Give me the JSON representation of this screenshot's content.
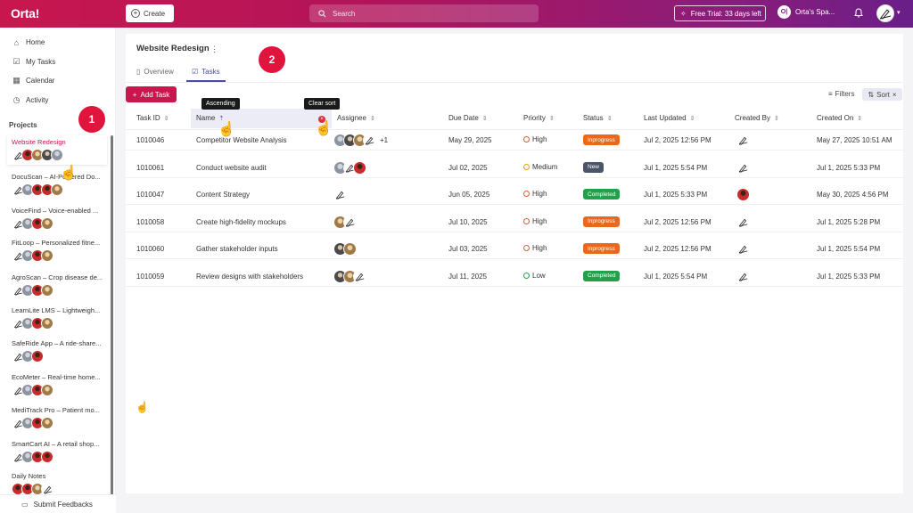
{
  "topbar": {
    "logo": "Orta!",
    "create_label": "Create",
    "search_placeholder": "Search",
    "trial_label": "Free Trial: 33 days left",
    "space_initials": "O|",
    "space_name": "Orta's Spa..."
  },
  "sidebar": {
    "nav": [
      {
        "label": "Home",
        "icon": "home-icon"
      },
      {
        "label": "My Tasks",
        "icon": "checkbox-icon"
      },
      {
        "label": "Calendar",
        "icon": "calendar-icon"
      },
      {
        "label": "Activity",
        "icon": "activity-icon"
      }
    ],
    "projects_title": "Projects",
    "projects": [
      {
        "name": "Website Redesign",
        "avatars": [
          "pen",
          "red",
          "brown",
          "dark",
          "grey"
        ],
        "active": true
      },
      {
        "name": "DocuScan – AI-Powered Do...",
        "avatars": [
          "pen",
          "grey",
          "red",
          "red",
          "brown"
        ]
      },
      {
        "name": "VoiceFind – Voice-enabled ...",
        "avatars": [
          "pen",
          "grey",
          "red",
          "brown"
        ]
      },
      {
        "name": "FitLoop – Personalized fitne...",
        "avatars": [
          "pen",
          "grey",
          "red",
          "brown"
        ]
      },
      {
        "name": "AgroScan – Crop disease de...",
        "avatars": [
          "pen",
          "grey",
          "red",
          "brown"
        ]
      },
      {
        "name": "LearnLite LMS – Lightweigh...",
        "avatars": [
          "pen",
          "grey",
          "red",
          "brown"
        ]
      },
      {
        "name": "SafeRide App – A ride-share...",
        "avatars": [
          "pen",
          "grey",
          "red"
        ]
      },
      {
        "name": "EcoMeter – Real-time home...",
        "avatars": [
          "pen",
          "grey",
          "red",
          "brown"
        ]
      },
      {
        "name": "MediTrack Pro – Patient mo...",
        "avatars": [
          "pen",
          "grey",
          "red",
          "brown"
        ]
      },
      {
        "name": "SmartCart AI – A retail shop...",
        "avatars": [
          "pen",
          "grey",
          "red",
          "red"
        ]
      },
      {
        "name": "Daily Notes",
        "avatars": [
          "red",
          "red",
          "brown",
          "pen"
        ]
      }
    ],
    "feedback_label": "Submit Feedbacks"
  },
  "main": {
    "project_title": "Website Redesign",
    "tabs": [
      {
        "label": "Overview"
      },
      {
        "label": "Tasks"
      }
    ],
    "add_task_label": "Add Task",
    "filters_label": "Filters",
    "sort_label": "Sort",
    "columns": [
      "Task ID",
      "Name",
      "Assignee",
      "Due Date",
      "Priority",
      "Status",
      "Last Updated",
      "Created By",
      "Created On"
    ],
    "tooltip_ascending": "Ascending",
    "tooltip_clear": "Clear sort",
    "rows": [
      {
        "id": "1010046",
        "name": "Competitor Website Analysis",
        "assignees": [
          "grey",
          "dark",
          "brown",
          "pen"
        ],
        "extra": "+1",
        "due": "May 29, 2025",
        "priority": "High",
        "status": "Inprogress",
        "updated": "Jul 2, 2025 12:56 PM",
        "creator": "pen",
        "created": "May 27, 2025 10:51 AM"
      },
      {
        "id": "1010061",
        "name": "Conduct website audit",
        "assignees": [
          "grey",
          "pen",
          "red"
        ],
        "extra": "",
        "due": "Jul 02, 2025",
        "priority": "Medium",
        "status": "New",
        "updated": "Jul 1, 2025 5:54 PM",
        "creator": "pen",
        "created": "Jul 1, 2025 5:33 PM"
      },
      {
        "id": "1010047",
        "name": "Content Strategy",
        "assignees": [
          "pen"
        ],
        "extra": "",
        "due": "Jun 05, 2025",
        "priority": "High",
        "status": "Completed",
        "updated": "Jul 1, 2025 5:33 PM",
        "creator": "red",
        "created": "May 30, 2025 4:56 PM"
      },
      {
        "id": "1010058",
        "name": "Create high-fidelity mockups",
        "assignees": [
          "brown",
          "pen"
        ],
        "extra": "",
        "due": "Jul 10, 2025",
        "priority": "High",
        "status": "Inprogress",
        "updated": "Jul 2, 2025 12:56 PM",
        "creator": "pen",
        "created": "Jul 1, 2025 5:28 PM"
      },
      {
        "id": "1010060",
        "name": "Gather stakeholder inputs",
        "assignees": [
          "dark",
          "brown"
        ],
        "extra": "",
        "due": "Jul 03, 2025",
        "priority": "High",
        "status": "Inprogress",
        "updated": "Jul 2, 2025 12:56 PM",
        "creator": "pen",
        "created": "Jul 1, 2025 5:54 PM"
      },
      {
        "id": "1010059",
        "name": "Review designs with stakeholders",
        "assignees": [
          "dark",
          "brown",
          "pen"
        ],
        "extra": "",
        "due": "Jul 11, 2025",
        "priority": "Low",
        "status": "Completed",
        "updated": "Jul 1, 2025 5:54 PM",
        "creator": "pen",
        "created": "Jul 1, 2025 5:33 PM"
      }
    ]
  },
  "callouts": [
    "1",
    "2"
  ],
  "colors": {
    "brand": "#c8174e",
    "inprogress": "#e8691c",
    "new": "#4a5568",
    "completed": "#22a04a",
    "high": "#e05a3a",
    "medium": "#e0a020",
    "low": "#22a04a"
  }
}
